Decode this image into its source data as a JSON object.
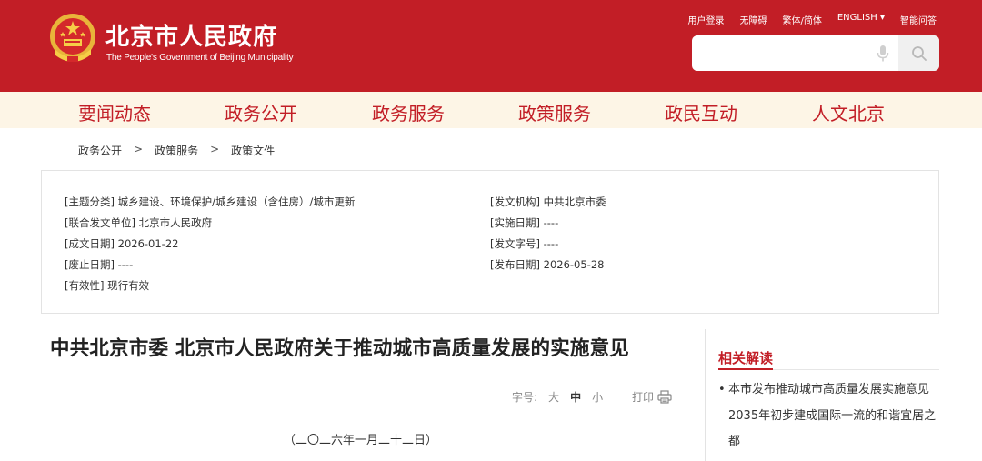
{
  "header": {
    "logo_cn": "北京市人民政府",
    "logo_en": "The People's Government of Beijing Municipality",
    "top_links": [
      "用户登录",
      "无障碍",
      "繁体/简体",
      "ENGLISH ▾",
      "智能问答"
    ],
    "search_placeholder": "",
    "brand_color": "#c21e26"
  },
  "nav": {
    "items": [
      "要闻动态",
      "政务公开",
      "政务服务",
      "政策服务",
      "政民互动",
      "人文北京"
    ]
  },
  "breadcrumb": {
    "items": [
      "政务公开",
      "政策服务",
      "政策文件"
    ],
    "separator": ">"
  },
  "meta": {
    "topic": "[主题分类] 城乡建设、环境保护/城乡建设（含住房）/城市更新",
    "joint_unit": "[联合发文单位] 北京市人民政府",
    "written_date": "[成文日期] 2026-01-22",
    "abolish_date": "[废止日期] ----",
    "validity": "[有效性] 现行有效",
    "issuer": "[发文机构] 中共北京市委",
    "effective_date": "[实施日期] ----",
    "doc_number": "[发文字号] ----",
    "publish_date": "[发布日期] 2026-05-28"
  },
  "article": {
    "title": "中共北京市委 北京市人民政府关于推动城市高质量发展的实施意见",
    "font_label": "字号:",
    "font_sizes": [
      "大",
      "中",
      "小"
    ],
    "print_label": "打印",
    "date_line": "（二〇二六年一月二十二日）"
  },
  "related": {
    "title": "相关解读",
    "items": [
      {
        "lines": [
          "本市发布推动城市高质量发展实施意见",
          "2035年初步建成国际一流的和谐宜居之",
          "都"
        ]
      }
    ]
  }
}
